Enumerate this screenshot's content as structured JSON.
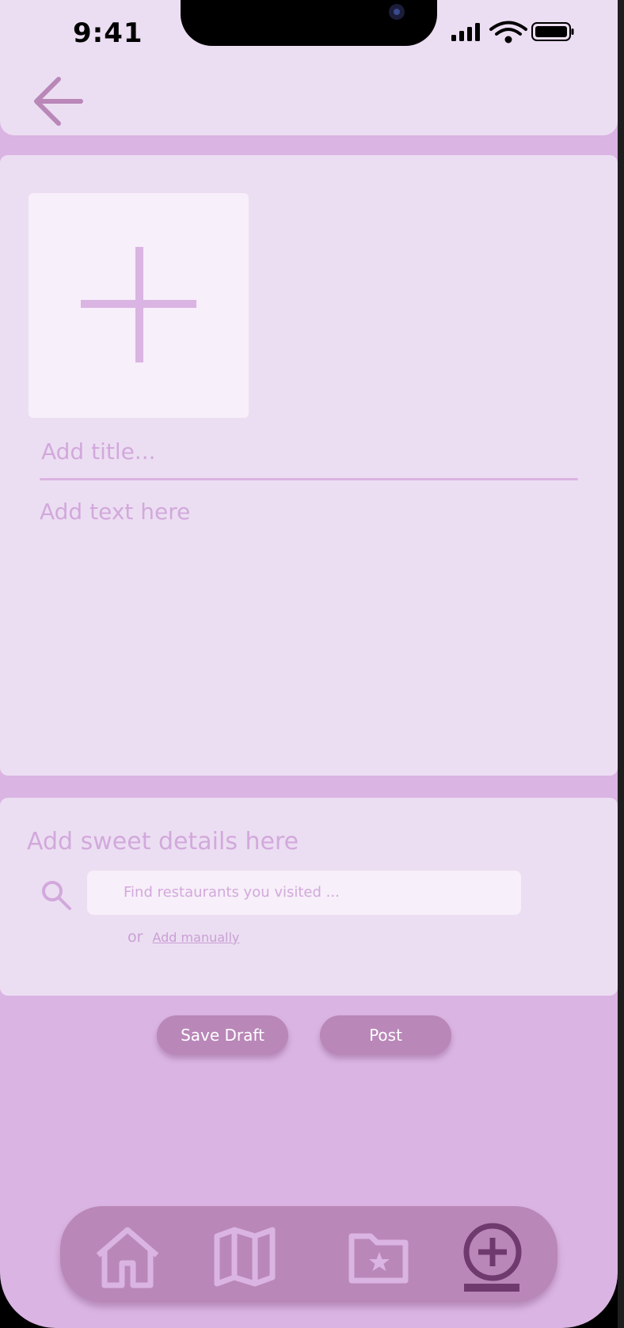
{
  "status_bar": {
    "time": "9:41",
    "icons": [
      "cellular-signal-icon",
      "wifi-icon",
      "battery-icon"
    ]
  },
  "header": {
    "back_icon": "arrow-left-icon"
  },
  "composer": {
    "add_photo_icon": "plus-icon",
    "title_placeholder": "Add title...",
    "text_placeholder": "Add text here"
  },
  "details": {
    "heading": "Add sweet details here",
    "search_icon": "search-icon",
    "search_placeholder": "Find restaurants you visited ...",
    "or_text": "or",
    "add_manually_link": "Add manually"
  },
  "actions": {
    "save_draft_label": "Save Draft",
    "post_label": "Post"
  },
  "bottom_nav": {
    "items": [
      {
        "icon": "home-icon",
        "active": false
      },
      {
        "icon": "map-icon",
        "active": false
      },
      {
        "icon": "saved-folder-icon",
        "active": false
      },
      {
        "icon": "add-post-icon",
        "active": true
      }
    ]
  },
  "colors": {
    "background": "#dab4e2",
    "card": "#ecdef2",
    "input_fill": "#f7eff9",
    "placeholder": "#d2a9dc",
    "accent": "#b987b8",
    "active_icon": "#6f3a6d"
  }
}
